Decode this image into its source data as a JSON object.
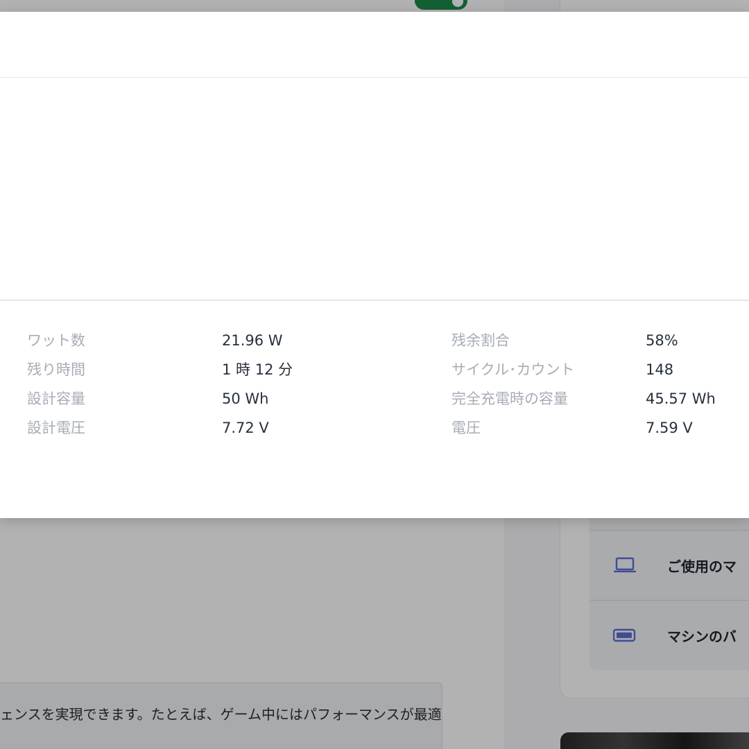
{
  "background": {
    "sidebar_items": [
      {
        "icon": "laptop-icon",
        "label": "ご使用のマ"
      },
      {
        "icon": "battery-icon",
        "label": "マシンのバ"
      }
    ],
    "info_text": "ェンスを実現できます。たとえば、ゲーム中にはパフォーマンスが最適",
    "accent_color": "#1e8a4c",
    "icon_color": "#5b6fd6"
  },
  "battery_details": {
    "left": [
      {
        "label": "ワット数",
        "value": "21.96 W"
      },
      {
        "label": "残り時間",
        "value": "1 時 12 分"
      },
      {
        "label": "設計容量",
        "value": "50 Wh"
      },
      {
        "label": "設計電圧",
        "value": "7.72 V"
      }
    ],
    "right": [
      {
        "label": "残余割合",
        "value": "58%"
      },
      {
        "label": "サイクル･カウント",
        "value": "148"
      },
      {
        "label": "完全充電時の容量",
        "value": "45.57 Wh"
      },
      {
        "label": "電圧",
        "value": "7.59 V"
      }
    ]
  }
}
